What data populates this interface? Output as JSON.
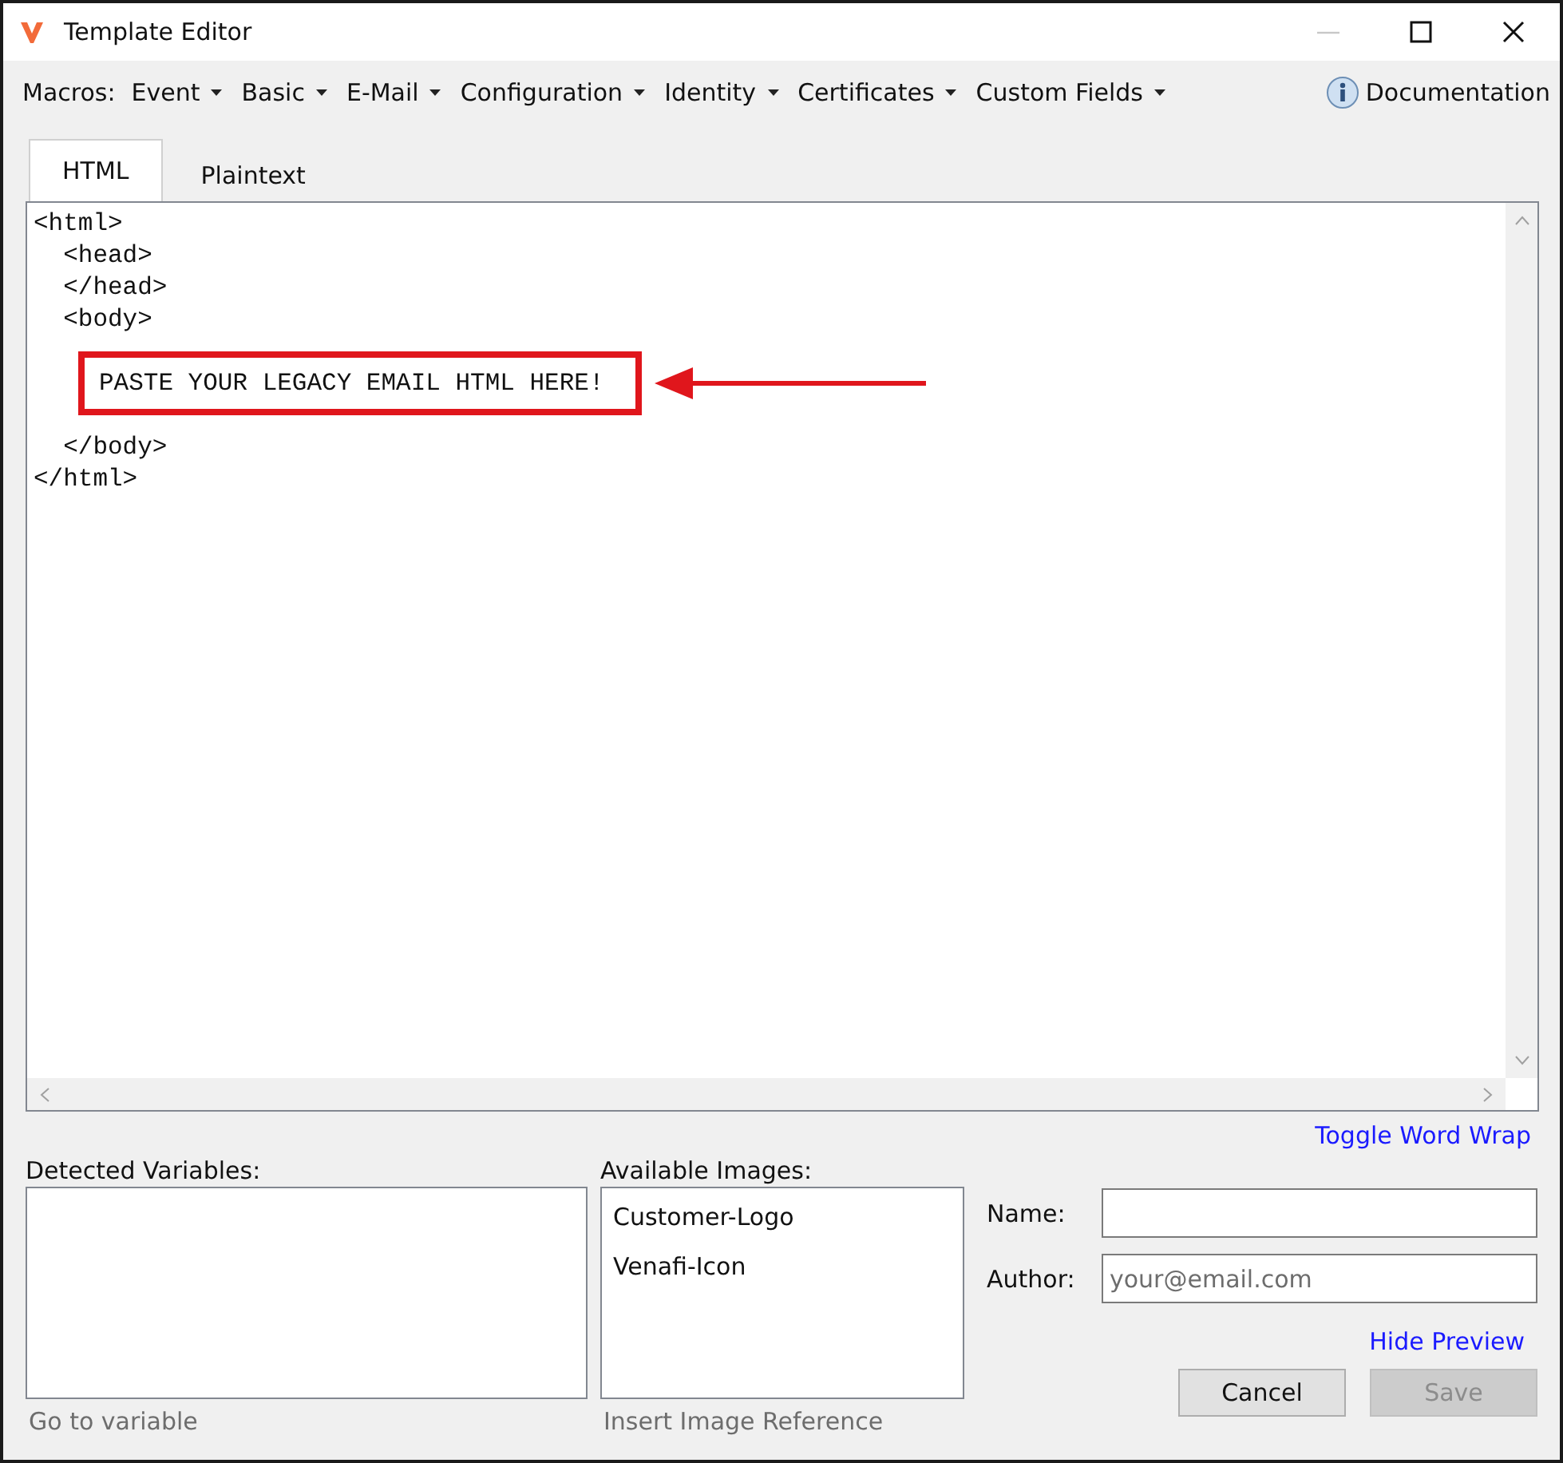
{
  "window": {
    "title": "Template Editor",
    "controls": [
      {
        "kind": "minimize",
        "disabled": true
      },
      {
        "kind": "maximize",
        "disabled": false
      },
      {
        "kind": "close",
        "disabled": false
      }
    ]
  },
  "menubar": {
    "label": "Macros:",
    "menus": [
      "Event",
      "Basic",
      "E-Mail",
      "Configuration",
      "Identity",
      "Certificates",
      "Custom Fields"
    ],
    "documentation": "Documentation"
  },
  "tabs": [
    {
      "label": "HTML",
      "selected": true
    },
    {
      "label": "Plaintext",
      "selected": false
    }
  ],
  "editor": {
    "lines": [
      {
        "text": "<html>",
        "highlighted": false
      },
      {
        "text": "  <head>",
        "highlighted": false
      },
      {
        "text": "  </head>",
        "highlighted": false
      },
      {
        "text": "  <body>",
        "highlighted": false
      },
      {
        "text": "PASTE YOUR LEGACY EMAIL HTML HERE!",
        "highlighted": true
      },
      {
        "text": "  </body>",
        "highlighted": false
      },
      {
        "text": "</html>",
        "highlighted": false
      }
    ]
  },
  "toggle_word_wrap": "Toggle Word Wrap",
  "detected_variables": {
    "label": "Detected Variables:",
    "action": {
      "label": "Go to variable",
      "disabled": true
    }
  },
  "available_images": {
    "label": "Available Images:",
    "items": [
      "Customer-Logo",
      "Venafi-Icon"
    ],
    "action": {
      "label": "Insert Image Reference",
      "disabled": true
    }
  },
  "form": {
    "name": {
      "label": "Name:"
    },
    "author": {
      "label": "Author:",
      "placeholder": "your@email.com"
    }
  },
  "hide_preview": "Hide Preview",
  "buttons": [
    {
      "label": "Cancel",
      "disabled": false
    },
    {
      "label": "Save",
      "disabled": true
    }
  ]
}
